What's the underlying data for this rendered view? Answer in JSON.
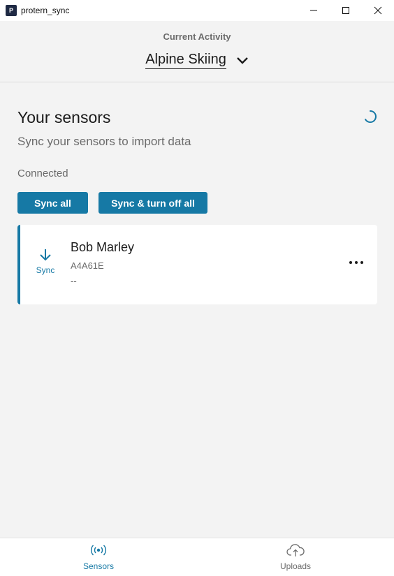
{
  "window": {
    "app_icon_letter": "P",
    "title": "protern_sync"
  },
  "header": {
    "caption": "Current Activity",
    "activity": "Alpine Skiing"
  },
  "sensors": {
    "title": "Your sensors",
    "subtitle": "Sync your sensors to import data",
    "connected_label": "Connected",
    "sync_all_label": "Sync all",
    "sync_off_label": "Sync & turn off all",
    "items": [
      {
        "name": "Bob Marley",
        "id": "A4A61E",
        "status": "--",
        "sync_label": "Sync"
      }
    ]
  },
  "nav": {
    "sensors_label": "Sensors",
    "uploads_label": "Uploads"
  },
  "colors": {
    "accent": "#1679a5",
    "background": "#f3f3f3",
    "card": "#ffffff"
  }
}
